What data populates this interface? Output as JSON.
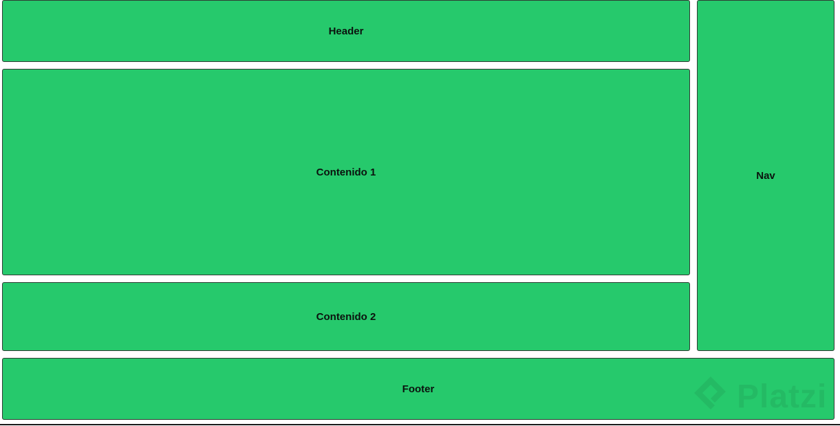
{
  "theme": {
    "box_color": "#26c96c",
    "border_color": "#2f3a33",
    "text_color": "#0b120e"
  },
  "boxes": {
    "header": "Header",
    "content1": "Contenido 1",
    "content2": "Contenido 2",
    "nav": "Nav",
    "footer": "Footer"
  },
  "watermark": {
    "brand": "Platzi",
    "icon": "platzi-logo-icon"
  }
}
